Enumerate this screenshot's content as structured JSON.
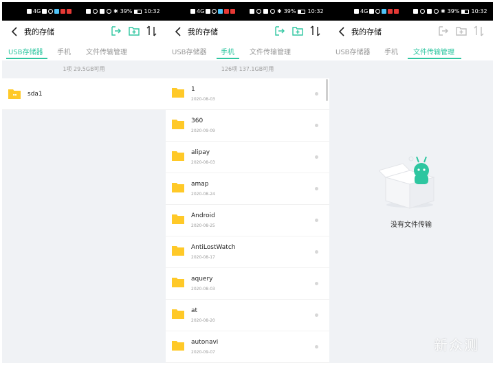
{
  "status": {
    "left_text": "4G",
    "battery": "39%",
    "time": "10:32"
  },
  "header": {
    "title": "我的存储"
  },
  "tabs": [
    "USB存储器",
    "手机",
    "文件传输管理"
  ],
  "icons": {
    "back": "back-arrow-icon",
    "export": "export-icon",
    "new_folder": "new-folder-icon",
    "sort": "sort-icon"
  },
  "colors": {
    "accent": "#2ec6a0",
    "folder": "#ffc928",
    "background_gray": "#f0f2f5"
  },
  "panel_usb": {
    "info": "1项 29.5GB可用",
    "items": [
      {
        "name": "sda1"
      }
    ]
  },
  "panel_phone": {
    "info": "126项 137.1GB可用",
    "items": [
      {
        "name": "1",
        "date": "2020-08-03"
      },
      {
        "name": "360",
        "date": "2020-09-09"
      },
      {
        "name": "alipay",
        "date": "2020-08-03"
      },
      {
        "name": "amap",
        "date": "2020-08-24"
      },
      {
        "name": "Android",
        "date": "2020-08-25"
      },
      {
        "name": "AntiLostWatch",
        "date": "2020-08-17"
      },
      {
        "name": "aquery",
        "date": "2020-08-03"
      },
      {
        "name": "at",
        "date": "2020-08-20"
      },
      {
        "name": "autonavi",
        "date": "2020-09-07"
      }
    ]
  },
  "panel_transfer": {
    "empty_text": "没有文件传输"
  },
  "watermark": "新众测"
}
